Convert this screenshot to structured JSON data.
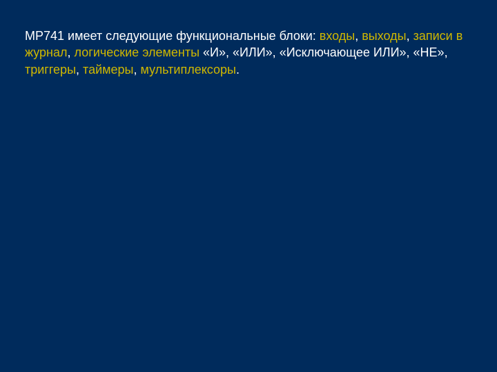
{
  "colors": {
    "background": "#002b5c",
    "text": "#ffffff",
    "highlight": "#d0b800"
  },
  "paragraph": {
    "segments": [
      {
        "text": "МР741 имеет следующие функциональные блоки: ",
        "highlight": false
      },
      {
        "text": "входы",
        "highlight": true
      },
      {
        "text": ", ",
        "highlight": false
      },
      {
        "text": "выходы",
        "highlight": true
      },
      {
        "text": ", ",
        "highlight": false
      },
      {
        "text": "записи в журнал",
        "highlight": true
      },
      {
        "text": ", ",
        "highlight": false
      },
      {
        "text": "логические элементы",
        "highlight": true
      },
      {
        "text": " «И», «ИЛИ», «Исключающее ИЛИ», «НЕ», ",
        "highlight": false
      },
      {
        "text": "триггеры",
        "highlight": true
      },
      {
        "text": ", ",
        "highlight": false
      },
      {
        "text": "таймеры",
        "highlight": true
      },
      {
        "text": ", ",
        "highlight": false
      },
      {
        "text": "мультиплексоры",
        "highlight": true
      },
      {
        "text": ".",
        "highlight": false
      }
    ]
  }
}
